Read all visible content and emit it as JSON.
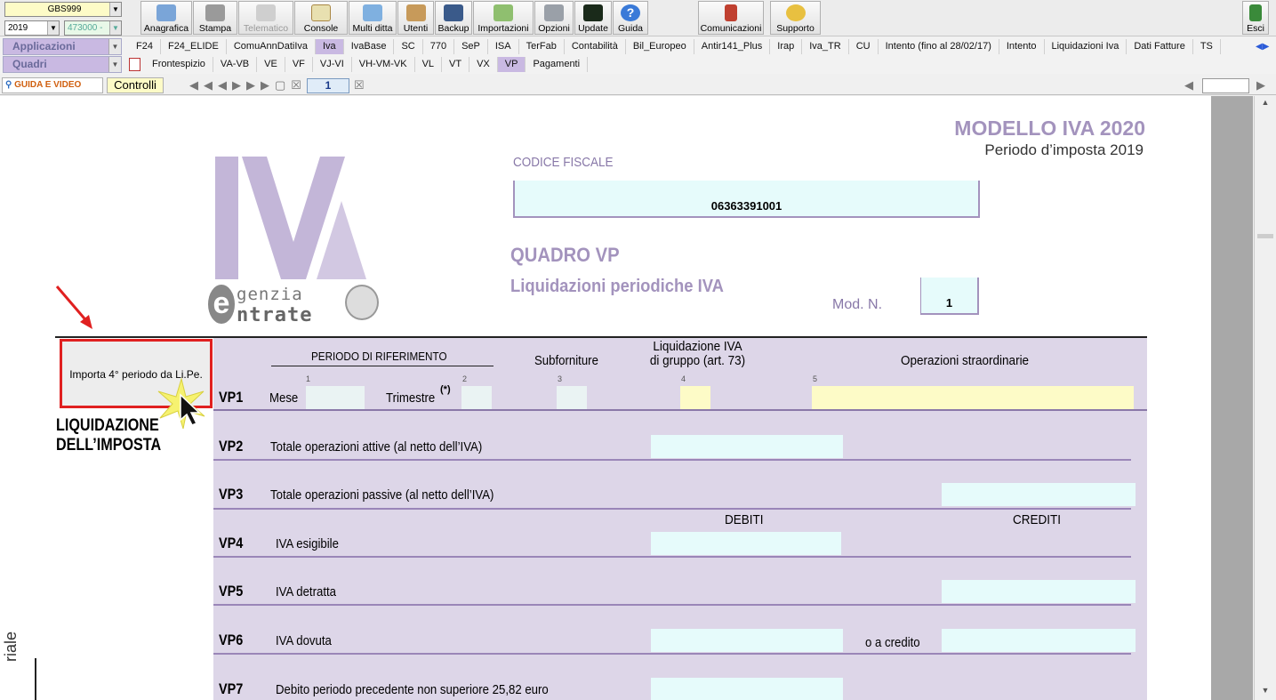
{
  "toolbar": {
    "company_code": "GBS999",
    "year": "2019",
    "code": "473000 -",
    "buttons": [
      "Anagrafica",
      "Stampa",
      "Telematico",
      "Console",
      "Multi ditta",
      "Utenti",
      "Backup",
      "Importazioni",
      "Opzioni",
      "Update",
      "Guida"
    ],
    "comunicazioni": "Comunicazioni",
    "supporto": "Supporto",
    "exit": "Esci"
  },
  "menu": {
    "applicazioni_label": "Applicazioni",
    "quadri_label": "Quadri",
    "app_tabs": [
      "F24",
      "F24_ELIDE",
      "ComuAnnDatiIva",
      "Iva",
      "IvaBase",
      "SC",
      "770",
      "SeP",
      "ISA",
      "TerFab",
      "Contabilità",
      "Bil_Europeo",
      "Antir141_Plus",
      "Irap",
      "Iva_TR",
      "CU",
      "Intento (fino al 28/02/17)",
      "Intento",
      "Liquidazioni Iva",
      "Dati Fatture",
      "TS"
    ],
    "app_active": "Iva",
    "quadri_tabs": [
      "Frontespizio",
      "VA-VB",
      "VE",
      "VF",
      "VJ-VI",
      "VH-VM-VK",
      "VL",
      "VT",
      "VX",
      "VP",
      "Pagamenti"
    ],
    "quadri_active": "VP"
  },
  "nav": {
    "guide_label": "GUIDA E VIDEO",
    "controlli_label": "Controlli",
    "page_number": "1"
  },
  "form": {
    "model_title": "MODELLO IVA 2020",
    "model_subtitle": "Periodo d’imposta 2019",
    "codice_fiscale_label": "CODICE FISCALE",
    "codice_fiscale": "06363391001",
    "quadro_title": "QUADRO VP",
    "quadro_subtitle": "Liquidazioni periodiche IVA",
    "mod_label": "Mod. N.",
    "mod_value": "1",
    "logo_word1": "genzia",
    "logo_word2": "ntrate",
    "import_button": "Importa 4° periodo da Li.Pe.",
    "section_title_1": "LIQUIDAZIONE",
    "section_title_2": "DELL’IMPOSTA",
    "side_text": "riale",
    "hdr_periodo": "PERIODO DI RIFERIMENTO",
    "hdr_subforniture": "Subforniture",
    "hdr_liq_1": "Liquidazione IVA",
    "hdr_liq_2": "di gruppo (art. 73)",
    "hdr_operazioni": "Operazioni straordinarie",
    "hdr_debiti": "DEBITI",
    "hdr_crediti": "CREDITI",
    "vp1_code": "VP1",
    "vp1_mese": "Mese",
    "vp1_trimestre": "Trimestre",
    "vp1_star": "(*)",
    "rows": [
      {
        "code": "VP2",
        "text": "Totale operazioni attive (al netto dell’IVA)"
      },
      {
        "code": "VP3",
        "text": "Totale operazioni passive (al netto dell’IVA)"
      },
      {
        "code": "VP4",
        "text": "IVA esigibile"
      },
      {
        "code": "VP5",
        "text": "IVA detratta"
      },
      {
        "code": "VP6",
        "text": "IVA dovuta"
      },
      {
        "code": "VP7",
        "text": "Debito periodo precedente non superiore 25,82 euro"
      }
    ],
    "vp6_credit": "o a credito",
    "field_numbers": [
      "1",
      "2",
      "3",
      "4",
      "5"
    ]
  },
  "colors": {
    "accent": "#c9b9e2",
    "form_purple": "#a393bd",
    "field_cyan": "#e6fbfb",
    "field_yellow": "#fdfbc7",
    "highlight_red": "#e02020"
  }
}
